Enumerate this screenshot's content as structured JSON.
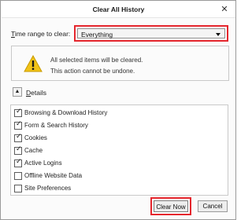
{
  "window": {
    "title": "Clear All History",
    "close_glyph": "✕"
  },
  "time_range": {
    "label_prefix": "",
    "label_accel": "T",
    "label_rest": "ime range to clear:",
    "selected": "Everything",
    "highlight_color": "#e5262d"
  },
  "warning": {
    "icon": "warning-triangle-icon",
    "line1": "All selected items will be cleared.",
    "line2": "This action cannot be undone."
  },
  "details": {
    "toggle_glyph": "▲",
    "label_accel": "D",
    "label_rest": "etails"
  },
  "items": [
    {
      "label": "Browsing & Download History",
      "checked": true
    },
    {
      "label": "Form & Search History",
      "checked": true
    },
    {
      "label": "Cookies",
      "checked": true
    },
    {
      "label": "Cache",
      "checked": true
    },
    {
      "label": "Active Logins",
      "checked": true
    },
    {
      "label": "Offline Website Data",
      "checked": false
    },
    {
      "label": "Site Preferences",
      "checked": false
    }
  ],
  "buttons": {
    "clear_now": "Clear Now",
    "cancel": "Cancel"
  }
}
